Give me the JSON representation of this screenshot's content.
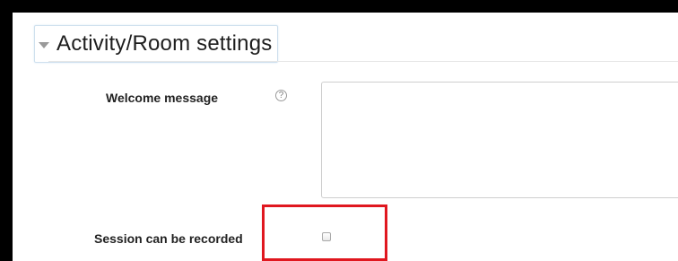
{
  "section": {
    "title": "Activity/Room settings",
    "collapse_icon": "caret-down-icon"
  },
  "welcome_message": {
    "label": "Welcome message",
    "help_icon": "help-icon",
    "help_glyph": "?",
    "value": "",
    "placeholder": ""
  },
  "session_recorded": {
    "label": "Session can be recorded",
    "checked": false
  },
  "annotation": {
    "highlight_color": "#e0171f"
  }
}
